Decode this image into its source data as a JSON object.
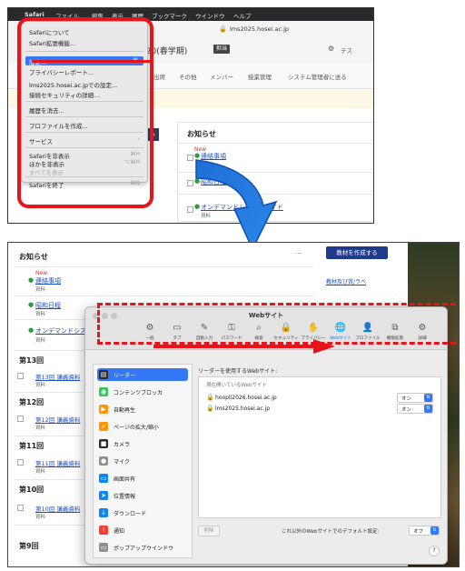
{
  "shot1": {
    "menubar": {
      "apple": "",
      "app": "Safari",
      "items": [
        "ファイル",
        "編集",
        "表示",
        "履歴",
        "ブックマーク",
        "ウインドウ",
        "ヘルプ"
      ]
    },
    "url": "lms2025.hosei.ac.jp",
    "course_title_fragment": "020(春学期)",
    "course_badge": "担当",
    "nav_items": [
      "出席",
      "その他",
      "メンバー",
      "授業管理",
      "システム管理者に送る"
    ],
    "menu": {
      "items": [
        {
          "label": "Safariについて",
          "shortcut": ""
        },
        {
          "label": "Safari拡張機能...",
          "shortcut": ""
        },
        {
          "label": "設定...",
          "shortcut": "⌘,"
        },
        {
          "label": "プライバシーレポート...",
          "shortcut": ""
        },
        {
          "label": "lms2025.hosei.ac.jpでの設定...",
          "shortcut": ""
        },
        {
          "label": "接続セキュリティの詳細...",
          "shortcut": ""
        },
        {
          "label": "履歴を消去...",
          "shortcut": ""
        },
        {
          "label": "プロファイルを作成...",
          "shortcut": ""
        },
        {
          "label": "サービス",
          "shortcut": "›"
        },
        {
          "label": "Safariを非表示",
          "shortcut": "⌘H"
        },
        {
          "label": "ほかを非表示",
          "shortcut": "⌥⌘H"
        },
        {
          "label": "すべてを表示",
          "shortcut": ""
        },
        {
          "label": "Safariを終了",
          "shortcut": "⌘Q"
        }
      ]
    },
    "notice": {
      "title": "お知らせ",
      "items": [
        {
          "new": "New",
          "title": "連絡事項",
          "sub": "資料"
        },
        {
          "new": "",
          "title": "昭和日程",
          "sub": ""
        },
        {
          "new": "",
          "title": "オンデマンドシステムガイド",
          "sub": "資料"
        }
      ]
    }
  },
  "shot2": {
    "notice_title": "お知らせ",
    "create_button": "教材を作成する",
    "notice_items": [
      {
        "new": "New",
        "title": "連絡事項",
        "sub": "資料"
      },
      {
        "new": "",
        "title": "昭和日程",
        "sub": "資料"
      },
      {
        "new": "",
        "title": "オンデマンドシステム",
        "sub": "資料"
      }
    ],
    "right_links": [
      "教材及び質/ラベ"
    ],
    "weeks": [
      {
        "title": "第13回",
        "item": "第13回  講義資料",
        "sub": "資料"
      },
      {
        "title": "第12回",
        "item": "第12回  講義資料",
        "sub": "資料"
      },
      {
        "title": "第11回",
        "item": "第11回  講義資料",
        "sub": "資料"
      },
      {
        "title": "第10回",
        "item": "第10回  講義資料",
        "sub": "資料"
      },
      {
        "title": "第9回",
        "item": "",
        "sub": ""
      }
    ],
    "prefs": {
      "title": "Webサイト",
      "tabs": [
        {
          "icon": "⚙",
          "label": "一般"
        },
        {
          "icon": "▭",
          "label": "タブ"
        },
        {
          "icon": "✎",
          "label": "自動入力"
        },
        {
          "icon": "⚿",
          "label": "パスワード"
        },
        {
          "icon": "⌕",
          "label": "検索"
        },
        {
          "icon": "🔒",
          "label": "セキュリティ"
        },
        {
          "icon": "✋",
          "label": "プライバシー"
        },
        {
          "icon": "🌐",
          "label": "Webサイト"
        },
        {
          "icon": "👤",
          "label": "プロファイル"
        },
        {
          "icon": "⧉",
          "label": "機能拡張"
        },
        {
          "icon": "⚙",
          "label": "詳細"
        }
      ],
      "sidebar": [
        {
          "label": "リーダー",
          "color": "#2c2c2e",
          "icon": "▤"
        },
        {
          "label": "コンテンツブロッカ",
          "color": "#34c759",
          "icon": "◉"
        },
        {
          "label": "自動再生",
          "color": "#ff9500",
          "icon": "▶"
        },
        {
          "label": "ページの拡大/縮小",
          "color": "#ff9500",
          "icon": "⌕"
        },
        {
          "label": "カメラ",
          "color": "#2c2c2e",
          "icon": "■"
        },
        {
          "label": "マイク",
          "color": "#8e8e93",
          "icon": "●"
        },
        {
          "label": "画面共有",
          "color": "#0a84ff",
          "icon": "▭"
        },
        {
          "label": "位置情報",
          "color": "#0a84ff",
          "icon": "➤"
        },
        {
          "label": "ダウンロード",
          "color": "#0a84ff",
          "icon": "↓"
        },
        {
          "label": "通知",
          "color": "#ff3b30",
          "icon": "!"
        },
        {
          "label": "ポップアップウインドウ",
          "color": "#8e8e93",
          "icon": "▭"
        }
      ],
      "content_header": "リーダーを使用するWebサイト:",
      "list_header": "現在開いているWebサイト",
      "sites": [
        {
          "domain": "hoopli2026.hosei.ac.jp",
          "value": "オン"
        },
        {
          "domain": "lms2025.hosei.ac.jp",
          "value": "オン"
        }
      ],
      "remove_button": "削除",
      "default_label": "これ以外のWebサイトでのデフォルト設定:",
      "default_value": "オフ",
      "help": "?"
    }
  },
  "colors": {
    "highlight": "#e8141b",
    "arrow": "#1f6fd6",
    "accent": "#3478f6"
  }
}
